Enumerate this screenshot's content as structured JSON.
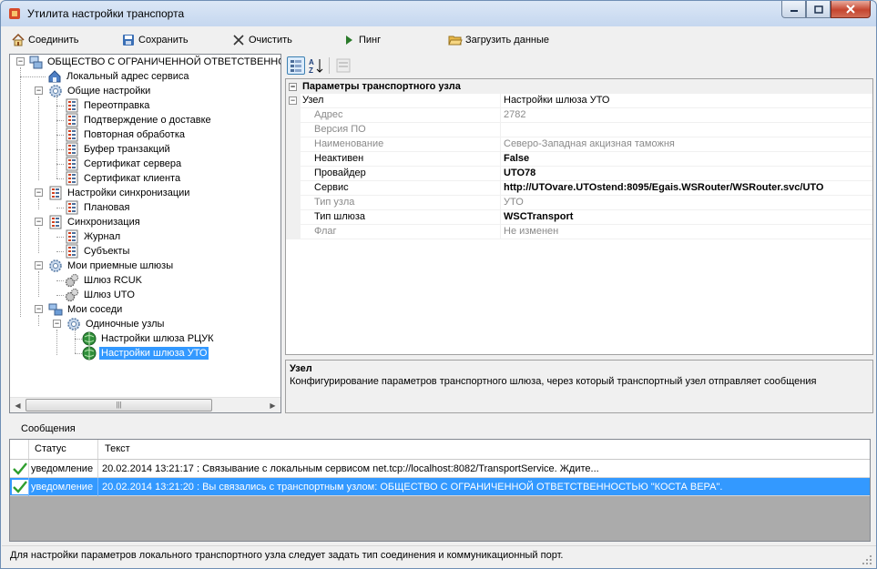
{
  "window": {
    "title": "Утилита настройки транспорта"
  },
  "toolbar": {
    "connect": "Соединить",
    "save": "Сохранить",
    "clear": "Очистить",
    "ping": "Пинг",
    "load": "Загрузить данные"
  },
  "tree": {
    "root": "ОБЩЕСТВО С ОГРАНИЧЕННОЙ ОТВЕТСТВЕННО",
    "local_address": "Локальный адрес сервиса",
    "general": "Общие настройки",
    "resend": "Переотправка",
    "delivery": "Подтверждение о доставке",
    "retry": "Повторная обработка",
    "buffer": "Буфер транзакций",
    "server_cert": "Сертификат сервера",
    "client_cert": "Сертификат клиента",
    "sync_settings": "Настройки синхронизации",
    "planned": "Плановая",
    "sync": "Синхронизация",
    "journal": "Журнал",
    "subjects": "Субъекты",
    "my_gateways": "Мои приемные шлюзы",
    "gw_rcuk": "Шлюз RCUK",
    "gw_uto": "Шлюз UTO",
    "neighbors": "Мои соседи",
    "single_nodes": "Одиночные узлы",
    "gw_settings_rcuk": "Настройки шлюза РЦУК",
    "gw_settings_uto": "Настройки шлюза УТО"
  },
  "propgrid": {
    "category": "Параметры транспортного узла",
    "node_name": "Узел",
    "node_value": "Настройки шлюза УТО",
    "props": [
      {
        "name": "Адрес",
        "value": "2782",
        "style": "ro"
      },
      {
        "name": "Версия ПО",
        "value": "",
        "style": "ro"
      },
      {
        "name": "Наименование",
        "value": "Северо-Западная акцизная таможня",
        "style": "ro"
      },
      {
        "name": "Неактивен",
        "value": "False",
        "style": "bold"
      },
      {
        "name": "Провайдер",
        "value": "UTO78",
        "style": "bold"
      },
      {
        "name": "Сервис",
        "value": "http://UTOvare.UTOstend:8095/Egais.WSRouter/WSRouter.svc/UTO",
        "style": "bold"
      },
      {
        "name": "Тип узла",
        "value": "УТО",
        "style": "ro"
      },
      {
        "name": "Тип шлюза",
        "value": "WSCTransport",
        "style": "bold"
      },
      {
        "name": "Флаг",
        "value": "Не изменен",
        "style": "ro"
      }
    ],
    "desc_title": "Узел",
    "desc_text": "Конфигурирование параметров транспортного шлюза, через который транспортный узел отправляет сообщения"
  },
  "messages": {
    "title": "Сообщения",
    "col_status": "Статус",
    "col_text": "Текст",
    "rows": [
      {
        "status": "уведомление",
        "text": "20.02.2014 13:21:17 : Связывание с локальным сервисом net.tcp://localhost:8082/TransportService. Ждите..."
      },
      {
        "status": "уведомление",
        "text": "20.02.2014 13:21:20 : Вы связались с транспортным узлом: ОБЩЕСТВО С ОГРАНИЧЕННОЙ ОТВЕТСТВЕННОСТЬЮ \"КОСТА ВЕРА\"."
      }
    ]
  },
  "statusbar": {
    "text": "Для настройки параметров локального транспортного узла следует задать тип соединения и коммуникационный порт."
  },
  "colors": {
    "selection": "#3399ff",
    "readonly_text": "#8a8a8a",
    "check_green": "#2e9e2e"
  }
}
